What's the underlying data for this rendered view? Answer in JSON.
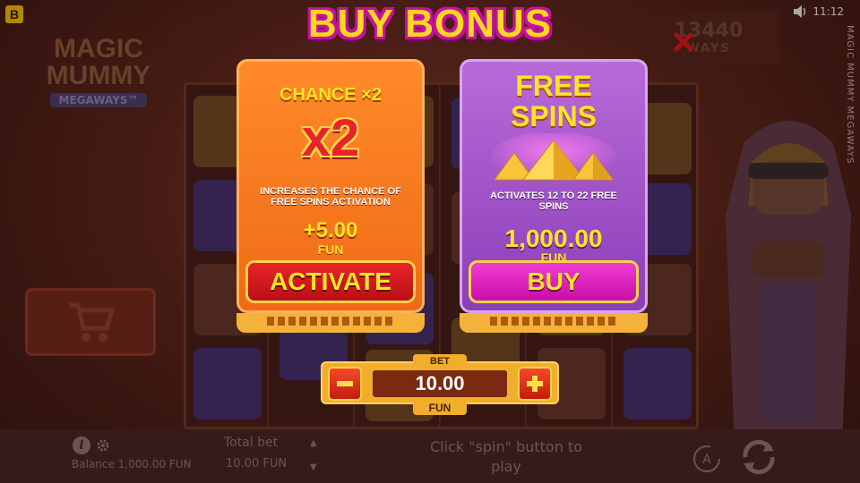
{
  "brand_badge": "B",
  "status_bar": {
    "time": "11:12"
  },
  "game_title_vertical": "MAGIC MUMMY MEGAWAYS",
  "logo": {
    "line1": "MAGIC",
    "line2": "MUMMY",
    "line3": "MEGAWAYS™"
  },
  "ways": {
    "count": "13440",
    "label": "WAYS"
  },
  "modal": {
    "title": "BUY BONUS",
    "chance_card": {
      "heading": "CHANCE ×2",
      "multiplier": "x2",
      "description": "INCREASES THE CHANCE OF FREE SPINS ACTIVATION",
      "price": "+5.00",
      "unit": "FUN",
      "button_label": "ACTIVATE"
    },
    "free_spins_card": {
      "heading_line1": "FREE",
      "heading_line2": "SPINS",
      "description": "ACTIVATES 12 TO 22 FREE SPINS",
      "price": "1,000.00",
      "unit": "FUN",
      "button_label": "BUY"
    },
    "bet": {
      "label": "BET",
      "value": "10.00",
      "unit": "FUN"
    }
  },
  "bottom_bar": {
    "balance": "Balance 1,000.00 FUN",
    "total_bet_label": "Total bet",
    "total_bet_value": "10.00 FUN",
    "hint": "Click \"spin\" button to play",
    "auto_label": "A"
  },
  "colors": {
    "title_fill": "#ffd81f",
    "title_outline": "#c5119d",
    "chance_card": "#f06a16",
    "free_spins_card": "#8a3fb8",
    "activate_button": "#d81a20",
    "buy_button": "#e024c4",
    "bet_panel": "#f3ad2c"
  },
  "icons": [
    "cart-icon",
    "close-x-icon",
    "info-icon",
    "gear-icon",
    "auto-spin-icon",
    "spin-icon",
    "minus-icon",
    "plus-icon",
    "pyramids-icon",
    "speaker-icon"
  ]
}
